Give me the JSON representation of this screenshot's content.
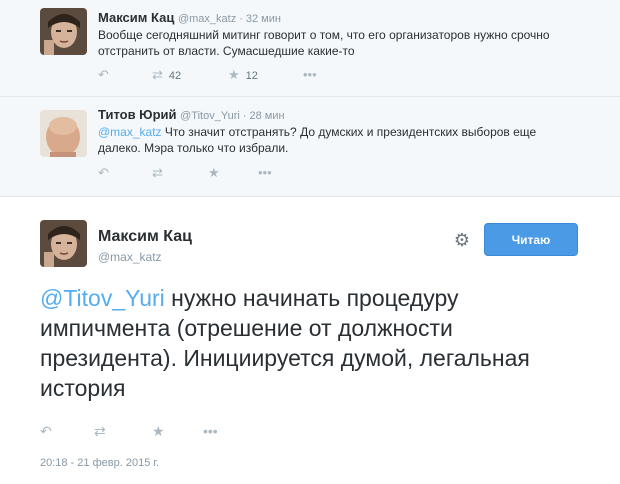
{
  "tweets": [
    {
      "fullname": "Максим Кац",
      "handle": "@max_katz",
      "time": "32 мин",
      "text": "Вообще сегодняшний митинг говорит о том, что его организаторов нужно срочно отстранить от власти. Сумасшедшие какие-то",
      "retweets": "42",
      "favorites": "12"
    },
    {
      "fullname": "Титов Юрий",
      "handle": "@Titov_Yuri",
      "time": "28 мин",
      "mention": "@max_katz",
      "text": " Что значит отстранять? До думских и президентских выборов еще далеко. Мэра только что избрали."
    }
  ],
  "main_tweet": {
    "fullname": "Максим Кац",
    "handle": "@max_katz",
    "follow_label": "Читаю",
    "mention": "@Titov_Yuri",
    "text": " нужно начинать процедуру импичмента (отрешение от должности президента). Инициируется думой, легальная история",
    "timestamp": "20:18 - 21 февр. 2015 г."
  },
  "icons": {
    "reply": "reply-icon",
    "retweet": "retweet-icon",
    "favorite": "star-icon",
    "more": "more-icon",
    "settings": "gear-icon"
  },
  "colors": {
    "link": "#55acee",
    "follow_button": "#4a9ae6",
    "reply_area_bg": "#f5f8fa"
  }
}
